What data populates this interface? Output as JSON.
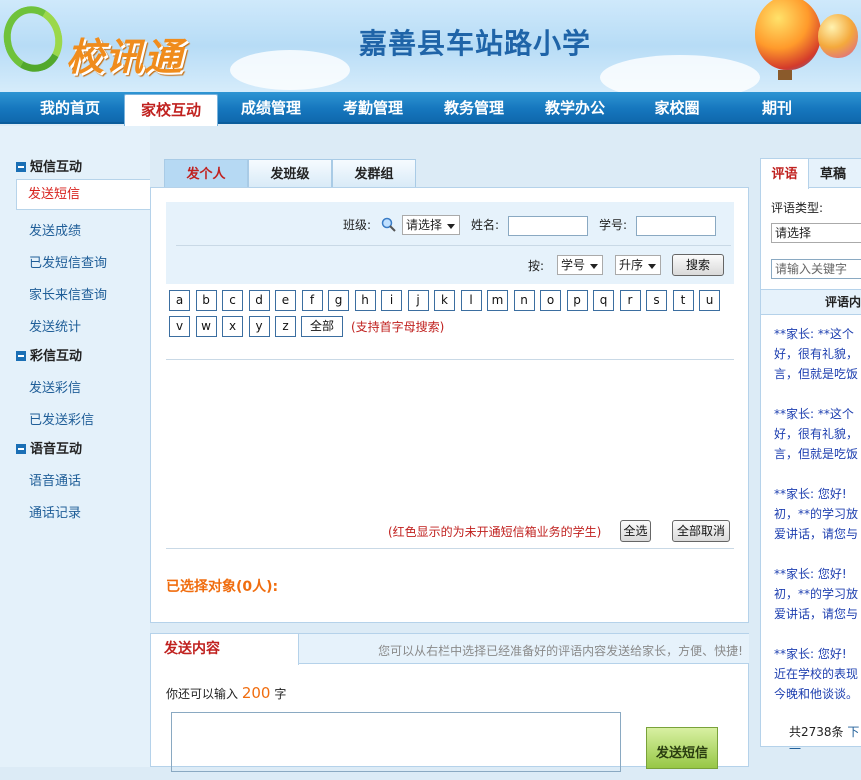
{
  "header": {
    "logo_text": "校讯通",
    "school_name": "嘉善县车站路小学"
  },
  "nav": [
    "我的首页",
    "家校互动",
    "成绩管理",
    "考勤管理",
    "教务管理",
    "教学办公",
    "家校圈",
    "期刊"
  ],
  "sidebar": {
    "groups": [
      "短信互动",
      "彩信互动",
      "语音互动"
    ],
    "items": [
      "发送短信",
      "发送成绩",
      "已发短信查询",
      "家长来信查询",
      "发送统计",
      "发送彩信",
      "已发送彩信",
      "语音通话",
      "通话记录"
    ]
  },
  "tabs": [
    "发个人",
    "发班级",
    "发群组"
  ],
  "filter": {
    "class_label": "班级:",
    "class_select": "请选择",
    "name_label": "姓名:",
    "id_label": "学号:",
    "sort_label": "按:",
    "sort_by": "学号",
    "sort_order": "升序",
    "search_button": "搜索"
  },
  "letters": [
    "a",
    "b",
    "c",
    "d",
    "e",
    "f",
    "g",
    "h",
    "i",
    "j",
    "k",
    "l",
    "m",
    "n",
    "o",
    "p",
    "q",
    "r",
    "s",
    "t",
    "u",
    "v",
    "w",
    "x",
    "y",
    "z"
  ],
  "letters_all": "全部",
  "letters_hint": "(支持首字母搜索)",
  "red_hint": "(红色显示的为未开通短信箱业务的学生)",
  "select_all": "全选",
  "deselect_all": "全部取消",
  "selected": "已选择对象(0人):",
  "send": {
    "tab": "发送内容",
    "note": "您可以从右栏中选择已经准备好的评语内容发送给家长，方便、快捷!",
    "remain_prefix": "你还可以输入",
    "remain_count": "200",
    "remain_suffix": "字",
    "button": "发送短信"
  },
  "right": {
    "tabs": [
      "评语",
      "草稿"
    ],
    "type_label": "评语类型:",
    "type_select": "请选择",
    "keyword_placeholder": "请输入关键字",
    "header": "评语内",
    "comments": [
      [
        "**家长: **这个",
        "好，很有礼貌，",
        "言，但就是吃饭"
      ],
      [
        "**家长: **这个",
        "好，很有礼貌，",
        "言，但就是吃饭"
      ],
      [
        "**家长: 您好!",
        "初，**的学习放",
        "爱讲话，请您与"
      ],
      [
        "**家长: 您好!",
        "初，**的学习放",
        "爱讲话，请您与"
      ],
      [
        "**家长: 您好!",
        "近在学校的表现",
        "今晚和他谈谈。"
      ]
    ],
    "total": "共2738条",
    "next": "下一"
  },
  "colors": {
    "nav_blue": "#1677be",
    "accent_red": "#c0211f",
    "orange": "#f06d0f"
  }
}
